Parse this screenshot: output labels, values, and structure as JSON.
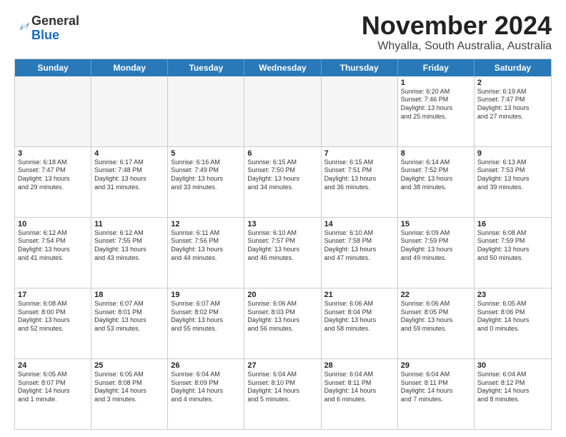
{
  "header": {
    "logo": {
      "line1": "General",
      "line2": "Blue"
    },
    "title": "November 2024",
    "location": "Whyalla, South Australia, Australia"
  },
  "calendar": {
    "days_of_week": [
      "Sunday",
      "Monday",
      "Tuesday",
      "Wednesday",
      "Thursday",
      "Friday",
      "Saturday"
    ],
    "rows": [
      {
        "cells": [
          {
            "empty": true
          },
          {
            "empty": true
          },
          {
            "empty": true
          },
          {
            "empty": true
          },
          {
            "empty": true
          },
          {
            "day": 1,
            "info": "Sunrise: 6:20 AM\nSunset: 7:46 PM\nDaylight: 13 hours\nand 25 minutes."
          },
          {
            "day": 2,
            "info": "Sunrise: 6:19 AM\nSunset: 7:47 PM\nDaylight: 13 hours\nand 27 minutes."
          }
        ]
      },
      {
        "cells": [
          {
            "day": 3,
            "info": "Sunrise: 6:18 AM\nSunset: 7:47 PM\nDaylight: 13 hours\nand 29 minutes."
          },
          {
            "day": 4,
            "info": "Sunrise: 6:17 AM\nSunset: 7:48 PM\nDaylight: 13 hours\nand 31 minutes."
          },
          {
            "day": 5,
            "info": "Sunrise: 6:16 AM\nSunset: 7:49 PM\nDaylight: 13 hours\nand 33 minutes."
          },
          {
            "day": 6,
            "info": "Sunrise: 6:15 AM\nSunset: 7:50 PM\nDaylight: 13 hours\nand 34 minutes."
          },
          {
            "day": 7,
            "info": "Sunrise: 6:15 AM\nSunset: 7:51 PM\nDaylight: 13 hours\nand 36 minutes."
          },
          {
            "day": 8,
            "info": "Sunrise: 6:14 AM\nSunset: 7:52 PM\nDaylight: 13 hours\nand 38 minutes."
          },
          {
            "day": 9,
            "info": "Sunrise: 6:13 AM\nSunset: 7:53 PM\nDaylight: 13 hours\nand 39 minutes."
          }
        ]
      },
      {
        "cells": [
          {
            "day": 10,
            "info": "Sunrise: 6:12 AM\nSunset: 7:54 PM\nDaylight: 13 hours\nand 41 minutes."
          },
          {
            "day": 11,
            "info": "Sunrise: 6:12 AM\nSunset: 7:55 PM\nDaylight: 13 hours\nand 43 minutes."
          },
          {
            "day": 12,
            "info": "Sunrise: 6:11 AM\nSunset: 7:56 PM\nDaylight: 13 hours\nand 44 minutes."
          },
          {
            "day": 13,
            "info": "Sunrise: 6:10 AM\nSunset: 7:57 PM\nDaylight: 13 hours\nand 46 minutes."
          },
          {
            "day": 14,
            "info": "Sunrise: 6:10 AM\nSunset: 7:58 PM\nDaylight: 13 hours\nand 47 minutes."
          },
          {
            "day": 15,
            "info": "Sunrise: 6:09 AM\nSunset: 7:59 PM\nDaylight: 13 hours\nand 49 minutes."
          },
          {
            "day": 16,
            "info": "Sunrise: 6:08 AM\nSunset: 7:59 PM\nDaylight: 13 hours\nand 50 minutes."
          }
        ]
      },
      {
        "cells": [
          {
            "day": 17,
            "info": "Sunrise: 6:08 AM\nSunset: 8:00 PM\nDaylight: 13 hours\nand 52 minutes."
          },
          {
            "day": 18,
            "info": "Sunrise: 6:07 AM\nSunset: 8:01 PM\nDaylight: 13 hours\nand 53 minutes."
          },
          {
            "day": 19,
            "info": "Sunrise: 6:07 AM\nSunset: 8:02 PM\nDaylight: 13 hours\nand 55 minutes."
          },
          {
            "day": 20,
            "info": "Sunrise: 6:06 AM\nSunset: 8:03 PM\nDaylight: 13 hours\nand 56 minutes."
          },
          {
            "day": 21,
            "info": "Sunrise: 6:06 AM\nSunset: 8:04 PM\nDaylight: 13 hours\nand 58 minutes."
          },
          {
            "day": 22,
            "info": "Sunrise: 6:06 AM\nSunset: 8:05 PM\nDaylight: 13 hours\nand 59 minutes."
          },
          {
            "day": 23,
            "info": "Sunrise: 6:05 AM\nSunset: 8:06 PM\nDaylight: 14 hours\nand 0 minutes."
          }
        ]
      },
      {
        "cells": [
          {
            "day": 24,
            "info": "Sunrise: 6:05 AM\nSunset: 8:07 PM\nDaylight: 14 hours\nand 1 minute."
          },
          {
            "day": 25,
            "info": "Sunrise: 6:05 AM\nSunset: 8:08 PM\nDaylight: 14 hours\nand 3 minutes."
          },
          {
            "day": 26,
            "info": "Sunrise: 6:04 AM\nSunset: 8:09 PM\nDaylight: 14 hours\nand 4 minutes."
          },
          {
            "day": 27,
            "info": "Sunrise: 6:04 AM\nSunset: 8:10 PM\nDaylight: 14 hours\nand 5 minutes."
          },
          {
            "day": 28,
            "info": "Sunrise: 6:04 AM\nSunset: 8:11 PM\nDaylight: 14 hours\nand 6 minutes."
          },
          {
            "day": 29,
            "info": "Sunrise: 6:04 AM\nSunset: 8:11 PM\nDaylight: 14 hours\nand 7 minutes."
          },
          {
            "day": 30,
            "info": "Sunrise: 6:04 AM\nSunset: 8:12 PM\nDaylight: 14 hours\nand 8 minutes."
          }
        ]
      }
    ]
  }
}
